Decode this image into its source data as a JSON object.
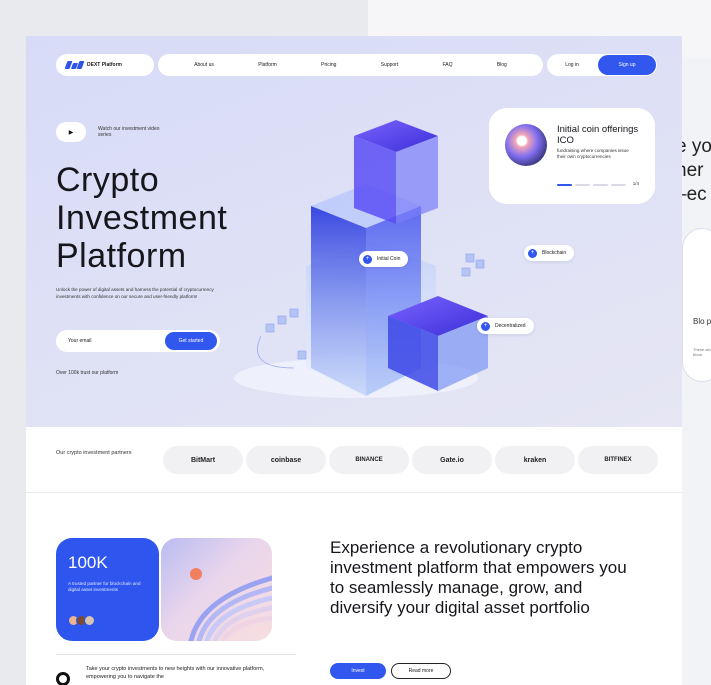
{
  "nav": {
    "brand": "DEXT Platform",
    "links": [
      "About us",
      "Platform",
      "Pricing",
      "Support",
      "FAQ",
      "Blog"
    ],
    "login": "Log in",
    "signup": "Sign up"
  },
  "hero": {
    "video_text": "Watch our investment video series",
    "title_lines": [
      "Crypto",
      "Investment",
      "Platform"
    ],
    "description": "Unlock the power of digital assets and harness the potential of cryptocurrency investments with confidence on our secure and user-friendly platform!",
    "email_placeholder": "Your email",
    "cta": "Get started",
    "trust": "Over 100k trust our platform",
    "tags": {
      "initial_coin": "Initial Coin",
      "blockchain": "Blockchain",
      "decentralized": "Decentralized"
    }
  },
  "ico_card": {
    "title": "Initial coin offerings ICO",
    "description": "fundraising where companies issue their own cryptocurrencies",
    "counter": "1/4"
  },
  "partners": {
    "label": "Our crypto investment partners",
    "items": [
      "BitMart",
      "coinbase",
      "BINANCE",
      "Gate.io",
      "kraken",
      "BITFINEX"
    ]
  },
  "stats": {
    "number": "100K",
    "description": "A trusted partner for blockchain and digital asset investments"
  },
  "headline": "Experience a revolutionary crypto investment platform that empowers you to seamlessly manage, grow, and diversify your digital asset portfolio",
  "buttons": {
    "invest": "Invest",
    "read_more": "Read more"
  },
  "bottom_text": "Take your crypto investments to new heights with our innovative platform, empowering you to navigate the",
  "peek": {
    "lines": [
      "e yo",
      "ner",
      "–ec"
    ],
    "card_title": "Blo pla",
    "card_desc": "These devel block"
  },
  "colors": {
    "accent": "#3157ee",
    "hero_bg": "#d9ddf6",
    "text": "#16161c"
  }
}
